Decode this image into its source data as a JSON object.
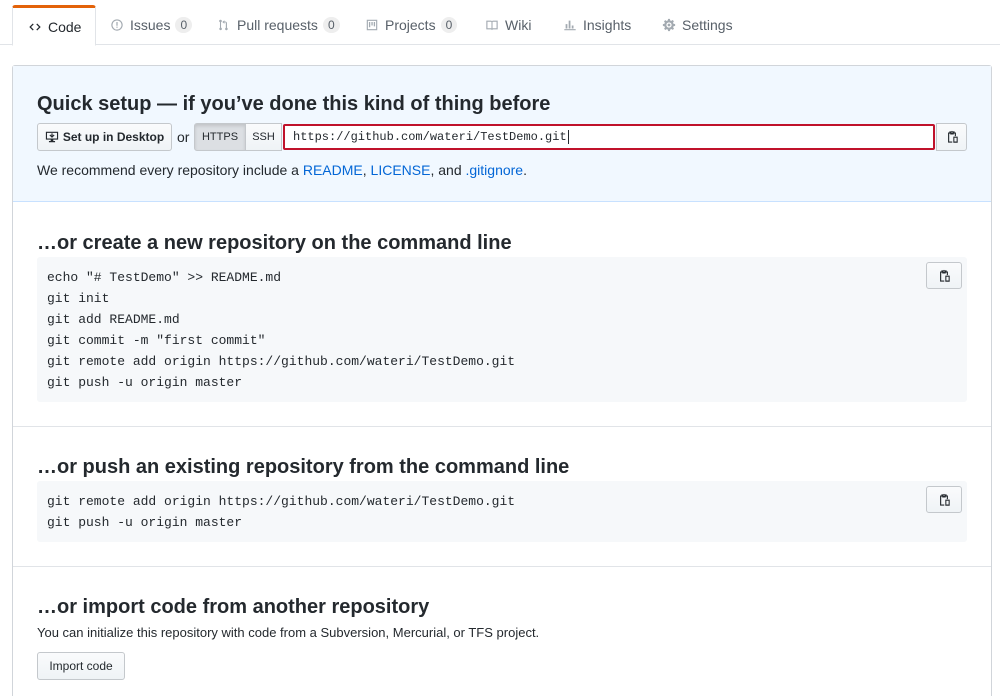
{
  "tabs": [
    {
      "label": "Code",
      "icon": "code-icon",
      "selected": true
    },
    {
      "label": "Issues",
      "icon": "issue-opened-icon",
      "count": "0"
    },
    {
      "label": "Pull requests",
      "icon": "git-pull-request-icon",
      "count": "0"
    },
    {
      "label": "Projects",
      "icon": "project-icon",
      "count": "0"
    },
    {
      "label": "Wiki",
      "icon": "book-icon"
    },
    {
      "label": "Insights",
      "icon": "graph-icon"
    },
    {
      "label": "Settings",
      "icon": "gear-icon"
    }
  ],
  "quick_setup": {
    "title": "Quick setup — if you’ve done this kind of thing before",
    "desktop_button": "Set up in Desktop",
    "or_text": "or",
    "https_label": "HTTPS",
    "ssh_label": "SSH",
    "clone_url": "https://github.com/wateri/TestDemo.git",
    "recommend_prefix": "We recommend every repository include a ",
    "readme_link": "README",
    "sep1": ", ",
    "license_link": "LICENSE",
    "sep2": ", and ",
    "gitignore_link": ".gitignore",
    "period": "."
  },
  "new_repo": {
    "title": "…or create a new repository on the command line",
    "lines": [
      "echo \"# TestDemo\" >> README.md",
      "git init",
      "git add README.md",
      "git commit -m \"first commit\"",
      "git remote add origin https://github.com/wateri/TestDemo.git",
      "git push -u origin master"
    ]
  },
  "push_existing": {
    "title": "…or push an existing repository from the command line",
    "lines": [
      "git remote add origin https://github.com/wateri/TestDemo.git",
      "git push -u origin master"
    ]
  },
  "import_code": {
    "title": "…or import code from another repository",
    "description": "You can initialize this repository with code from a Subversion, Mercurial, or TFS project.",
    "button": "Import code"
  },
  "colors": {
    "accent_tab": "#e36209",
    "link": "#0366d6",
    "url_input_border": "#c0122b",
    "quick_bg": "#f1f8ff"
  }
}
